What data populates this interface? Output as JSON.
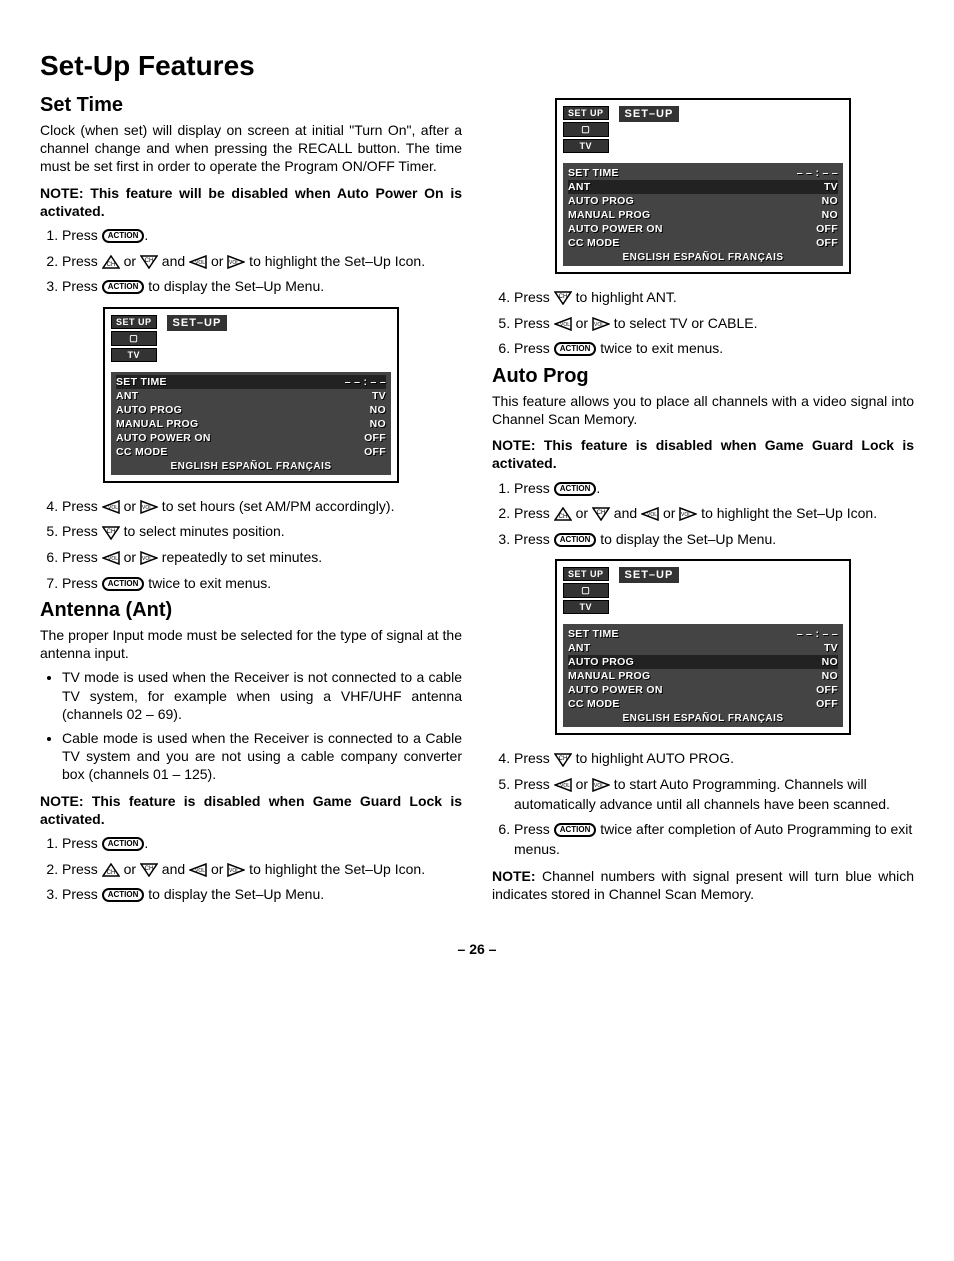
{
  "title": "Set-Up Features",
  "pagenum": "– 26 –",
  "icons": {
    "action": "ACTION",
    "up": "CH▲",
    "down": "CH▼",
    "left": "VOL◄",
    "right": "VOL►"
  },
  "menu": {
    "top_icons": [
      "SET UP",
      "▢",
      "TV"
    ],
    "label": "SET–UP",
    "rows": [
      {
        "l": "SET TIME",
        "r": "– – : – –"
      },
      {
        "l": "ANT",
        "r": "TV"
      },
      {
        "l": "AUTO PROG",
        "r": "NO"
      },
      {
        "l": "MANUAL PROG",
        "r": "NO"
      },
      {
        "l": "AUTO POWER ON",
        "r": "OFF"
      },
      {
        "l": "CC MODE",
        "r": "OFF"
      }
    ],
    "lang": "ENGLISH  ESPAÑOL  FRANÇAIS"
  },
  "set_time": {
    "heading": "Set Time",
    "intro": "Clock (when set) will display on screen at initial \"Turn On\", after a channel change and when pressing the RECALL button. The time must be set first in order to operate the Program ON/OFF Timer.",
    "note_label": "NOTE:",
    "note": "This feature will be disabled when Auto Power On is activated.",
    "s1a": "Press ",
    "s1b": ".",
    "s2a": "Press ",
    "s2b": " or ",
    "s2c": " and ",
    "s2d": " or ",
    "s2e": " to highlight the Set–Up Icon.",
    "s3a": "Press ",
    "s3b": " to display the Set–Up Menu.",
    "s4a": "Press ",
    "s4b": " or ",
    "s4c": " to set hours (set AM/PM accordingly).",
    "s5a": "Press ",
    "s5b": " to select minutes position.",
    "s6a": "Press ",
    "s6b": " or ",
    "s6c": " repeatedly to set minutes.",
    "s7a": "Press ",
    "s7b": " twice to exit menus."
  },
  "antenna": {
    "heading": "Antenna (Ant)",
    "intro": "The proper Input mode must be selected for the type of signal at the antenna input.",
    "b1": "TV mode is used when the Receiver is not connected to a cable TV system, for example when using a VHF/UHF antenna (channels 02 – 69).",
    "b2": "Cable mode is used when the Receiver is connected to a Cable TV system and you are not using a cable company converter box (channels 01 – 125).",
    "note_label": "NOTE:",
    "note": "This feature is disabled when Game Guard Lock is activated.",
    "s1a": "Press ",
    "s1b": ".",
    "s2a": "Press ",
    "s2b": " or ",
    "s2c": " and ",
    "s2d": " or ",
    "s2e": " to highlight the Set–Up Icon.",
    "s3a": "Press ",
    "s3b": " to display the Set–Up Menu.",
    "s4a": "Press ",
    "s4b": " to highlight ANT.",
    "s5a": "Press ",
    "s5b": " or ",
    "s5c": " to select TV or CABLE.",
    "s6a": "Press ",
    "s6b": " twice to exit menus."
  },
  "autoprog": {
    "heading": "Auto Prog",
    "intro": "This feature allows you to place all channels with a video signal into Channel Scan Memory.",
    "note_label": "NOTE:",
    "note": "This feature is disabled when Game Guard Lock is activated.",
    "s1a": "Press ",
    "s1b": ".",
    "s2a": "Press ",
    "s2b": " or ",
    "s2c": " and ",
    "s2d": " or ",
    "s2e": " to highlight the Set–Up Icon.",
    "s3a": "Press ",
    "s3b": " to display the Set–Up Menu.",
    "s4a": "Press ",
    "s4b": " to highlight AUTO PROG.",
    "s5a": "Press ",
    "s5b": " or ",
    "s5c": " to start Auto Programming. Channels will automatically advance until all channels have been scanned.",
    "s6a": "Press ",
    "s6b": " twice after completion of Auto Programming to exit menus.",
    "note2_label": "NOTE:",
    "note2": "Channel numbers with signal present will turn blue which indicates stored in Channel Scan Memory."
  }
}
